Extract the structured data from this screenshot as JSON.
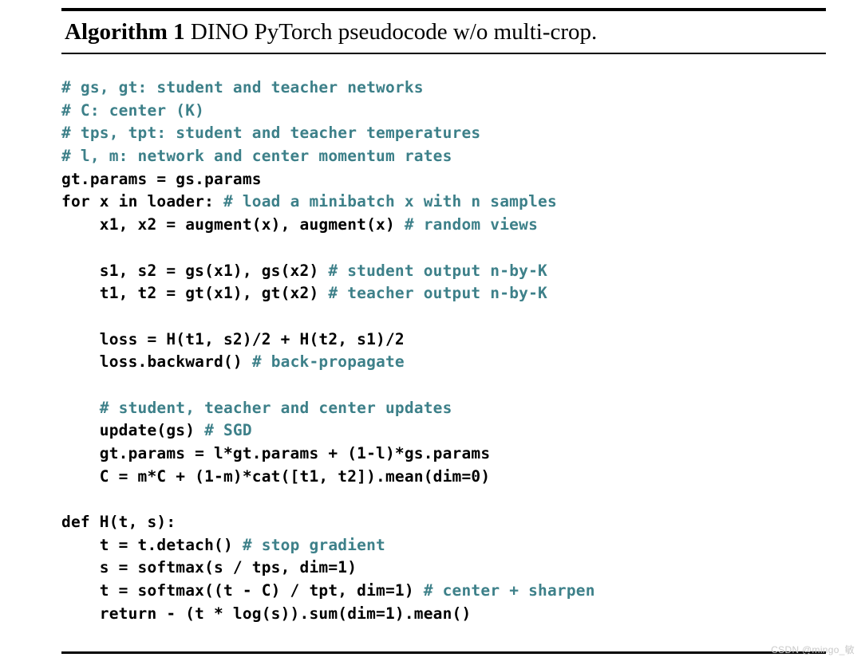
{
  "algorithm": {
    "title_label": "Algorithm 1",
    "title_caption": " DINO PyTorch pseudocode w/o multi-crop.",
    "comment_color": "#3d8089",
    "code_color": "#000000"
  },
  "code": {
    "lines": [
      {
        "indent": 0,
        "code": "",
        "comment": "# gs, gt: student and teacher networks"
      },
      {
        "indent": 0,
        "code": "",
        "comment": "# C: center (K)"
      },
      {
        "indent": 0,
        "code": "",
        "comment": "# tps, tpt: student and teacher temperatures"
      },
      {
        "indent": 0,
        "code": "",
        "comment": "# l, m: network and center momentum rates"
      },
      {
        "indent": 0,
        "code": "gt.params = gs.params",
        "comment": ""
      },
      {
        "indent": 0,
        "code": "for x in loader: ",
        "comment": "# load a minibatch x with n samples"
      },
      {
        "indent": 1,
        "code": "x1, x2 = augment(x), augment(x) ",
        "comment": "# random views"
      },
      {
        "indent": 0,
        "code": "",
        "comment": ""
      },
      {
        "indent": 1,
        "code": "s1, s2 = gs(x1), gs(x2) ",
        "comment": "# student output n-by-K"
      },
      {
        "indent": 1,
        "code": "t1, t2 = gt(x1), gt(x2) ",
        "comment": "# teacher output n-by-K"
      },
      {
        "indent": 0,
        "code": "",
        "comment": ""
      },
      {
        "indent": 1,
        "code": "loss = H(t1, s2)/2 + H(t2, s1)/2",
        "comment": ""
      },
      {
        "indent": 1,
        "code": "loss.backward() ",
        "comment": "# back-propagate"
      },
      {
        "indent": 0,
        "code": "",
        "comment": ""
      },
      {
        "indent": 1,
        "code": "",
        "comment": "# student, teacher and center updates"
      },
      {
        "indent": 1,
        "code": "update(gs) ",
        "comment": "# SGD"
      },
      {
        "indent": 1,
        "code": "gt.params = l*gt.params + (1-l)*gs.params",
        "comment": ""
      },
      {
        "indent": 1,
        "code": "C = m*C + (1-m)*cat([t1, t2]).mean(dim=0)",
        "comment": ""
      },
      {
        "indent": 0,
        "code": "",
        "comment": ""
      },
      {
        "indent": 0,
        "code": "def H(t, s):",
        "comment": ""
      },
      {
        "indent": 1,
        "code": "t = t.detach() ",
        "comment": "# stop gradient"
      },
      {
        "indent": 1,
        "code": "s = softmax(s / tps, dim=1)",
        "comment": ""
      },
      {
        "indent": 1,
        "code": "t = softmax((t - C) / tpt, dim=1) ",
        "comment": "# center + sharpen"
      },
      {
        "indent": 1,
        "code": "return - (t * log(s)).sum(dim=1).mean()",
        "comment": ""
      }
    ]
  },
  "watermark": {
    "text": "CSDN @mingo_敏"
  }
}
